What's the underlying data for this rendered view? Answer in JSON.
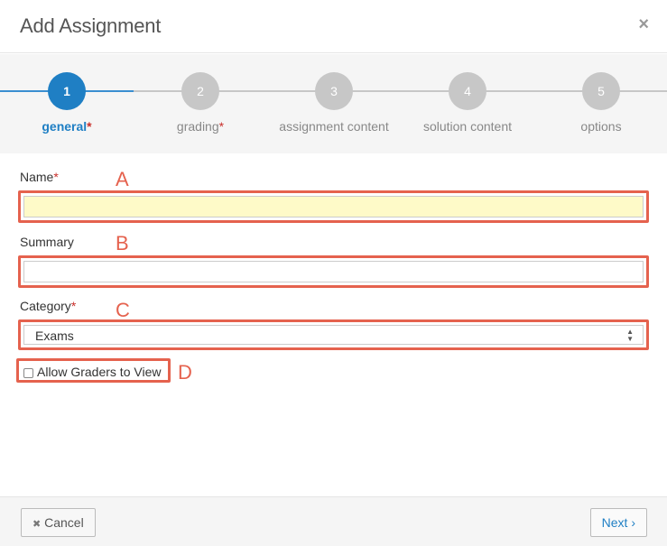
{
  "dialog": {
    "title": "Add Assignment",
    "close_glyph": "×"
  },
  "wizard": {
    "steps": [
      {
        "number": "1",
        "label": "general",
        "required": "*",
        "active": true
      },
      {
        "number": "2",
        "label": "grading",
        "required": "*",
        "active": false
      },
      {
        "number": "3",
        "label": "assignment content",
        "required": "",
        "active": false
      },
      {
        "number": "4",
        "label": "solution content",
        "required": "",
        "active": false
      },
      {
        "number": "5",
        "label": "options",
        "required": "",
        "active": false
      }
    ]
  },
  "form": {
    "name": {
      "label": "Name",
      "required": "*",
      "value": "",
      "annotation": "A"
    },
    "summary": {
      "label": "Summary",
      "required": "",
      "value": "",
      "annotation": "B"
    },
    "category": {
      "label": "Category",
      "required": "*",
      "selected": "Exams",
      "annotation": "C"
    },
    "allow_graders": {
      "label": "Allow Graders to View",
      "checked": false,
      "annotation": "D"
    }
  },
  "footer": {
    "cancel_icon": "✖",
    "cancel_label": "Cancel",
    "next_label": "Next",
    "next_icon": "›"
  },
  "colors": {
    "accent": "#1f7fc4",
    "annotation": "#e5624e",
    "required": "#c9302c",
    "highlight_input": "#fefac8"
  }
}
